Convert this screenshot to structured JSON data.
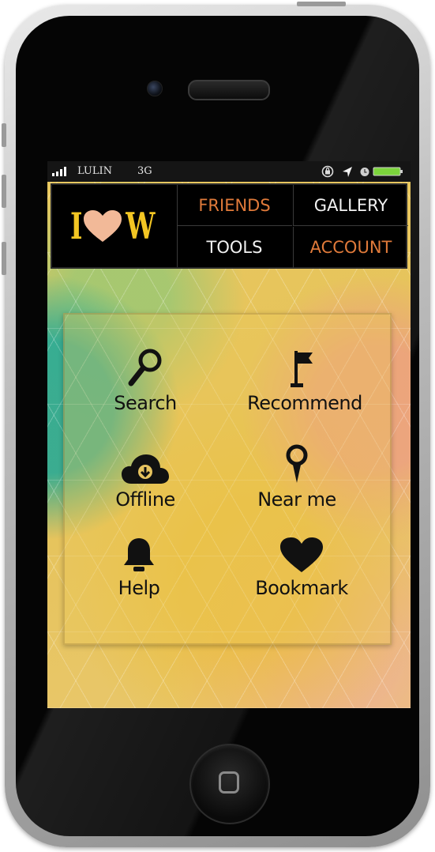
{
  "status_bar": {
    "carrier": "LULIN",
    "network": "3G",
    "signal_bars": 4,
    "icons": [
      "rotation-lock-icon",
      "location-arrow-icon",
      "alarm-icon",
      "battery-icon"
    ],
    "battery_color": "#7cd43c"
  },
  "header": {
    "logo": {
      "left_letter": "I",
      "right_letter": "W",
      "heart_color": "#f2b998",
      "letter_color": "#f3c623"
    },
    "nav": [
      {
        "label": "FRIENDS",
        "style": "orange"
      },
      {
        "label": "GALLERY",
        "style": "white"
      },
      {
        "label": "TOOLS",
        "style": "white"
      },
      {
        "label": "ACCOUNT",
        "style": "orange"
      }
    ],
    "accent_color": "#e07a3a"
  },
  "menu": [
    {
      "label": "Search",
      "icon": "search-icon"
    },
    {
      "label": "Recommend",
      "icon": "flag-icon"
    },
    {
      "label": "Offline",
      "icon": "cloud-download-icon"
    },
    {
      "label": "Near me",
      "icon": "map-pin-icon"
    },
    {
      "label": "Help",
      "icon": "bell-icon"
    },
    {
      "label": "Bookmark",
      "icon": "heart-icon"
    }
  ]
}
